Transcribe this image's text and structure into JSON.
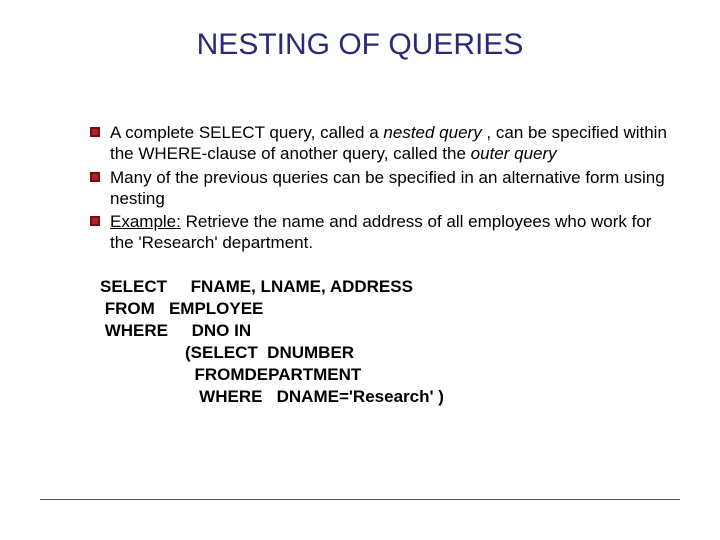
{
  "title": "NESTING OF QUERIES",
  "bullets": {
    "b1": {
      "p1": "A complete SELECT query, called a ",
      "p2": "nested query",
      "p3": " , can be specified within the WHERE-clause of another query, called the ",
      "p4": "outer query"
    },
    "b2": "Many of the previous queries can be specified in an alternative form using nesting",
    "b3": {
      "p1": "Example:",
      "p2": " Retrieve the name and address of all employees who work for the 'Research' department."
    }
  },
  "code": {
    "l1": "SELECT     FNAME, LNAME, ADDRESS",
    "l2": " FROM   EMPLOYEE",
    "l3": " WHERE     DNO IN",
    "l4": "                  (SELECT  DNUMBER",
    "l5": "                    FROMDEPARTMENT",
    "l6": "                     WHERE   DNAME='Research' )"
  }
}
